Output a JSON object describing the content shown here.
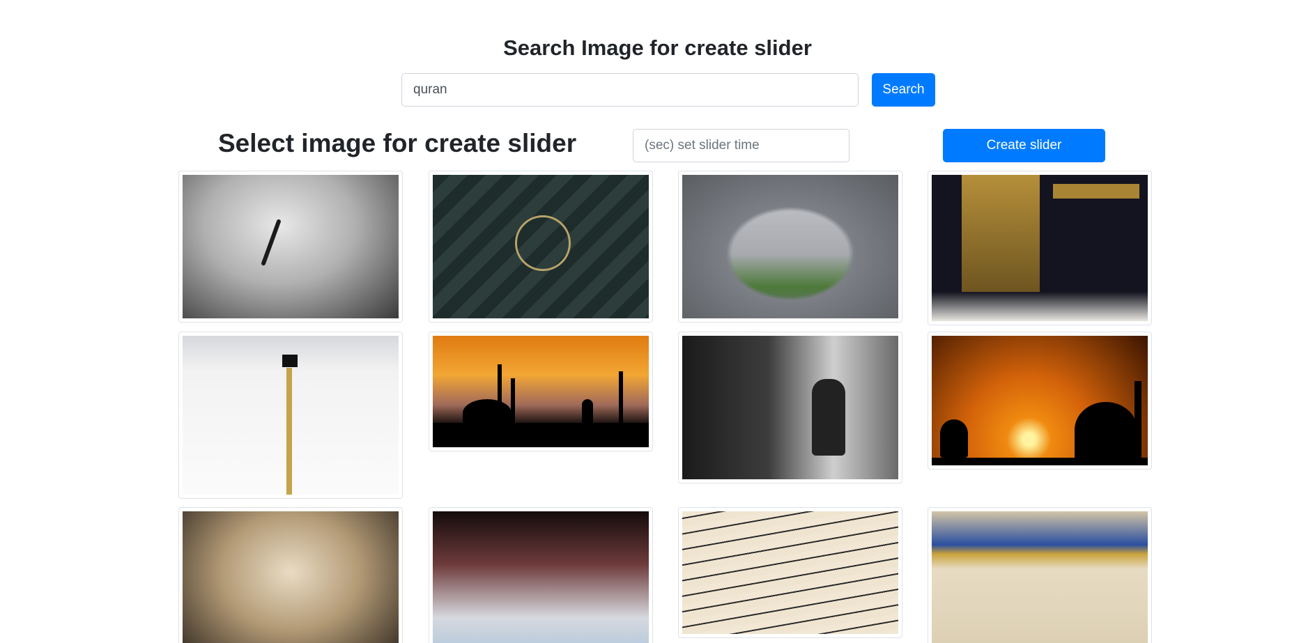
{
  "search": {
    "title": "Search Image for create slider",
    "query_value": "quran",
    "button_label": "Search"
  },
  "slider": {
    "title": "Select image for create slider",
    "time_placeholder": "(sec) set slider time",
    "create_button_label": "Create slider"
  },
  "colors": {
    "primary": "#007bff",
    "text": "#212529",
    "border": "#dee2e6"
  }
}
